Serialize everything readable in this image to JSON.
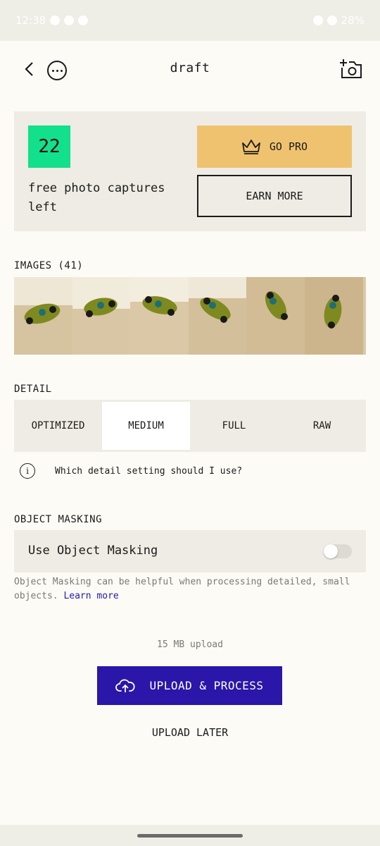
{
  "status_bar": {
    "time": "12:38",
    "battery": "28%"
  },
  "header": {
    "title": "draft"
  },
  "captures": {
    "count": "22",
    "text": "free photo captures left",
    "go_pro_label": "GO PRO",
    "earn_more_label": "EARN MORE"
  },
  "images": {
    "label": "IMAGES (41)",
    "thumbnail_count_visible": 6
  },
  "detail": {
    "label": "DETAIL",
    "options": [
      "OPTIMIZED",
      "MEDIUM",
      "FULL",
      "RAW"
    ],
    "selected": "MEDIUM",
    "help_text": "Which detail setting should I use?"
  },
  "masking": {
    "label": "OBJECT MASKING",
    "toggle_label": "Use Object Masking",
    "enabled": false,
    "help_text": "Object Masking can be helpful when processing detailed, small objects.",
    "learn_more": "Learn more"
  },
  "upload": {
    "size_text": "15 MB upload",
    "primary_label": "UPLOAD & PROCESS",
    "later_label": "UPLOAD LATER"
  },
  "colors": {
    "background": "#fcfbf6",
    "card": "#eeece4",
    "count_badge": "#12e08a",
    "go_pro": "#efc26f",
    "primary_button": "#2a16a8",
    "link": "#241ca6"
  }
}
